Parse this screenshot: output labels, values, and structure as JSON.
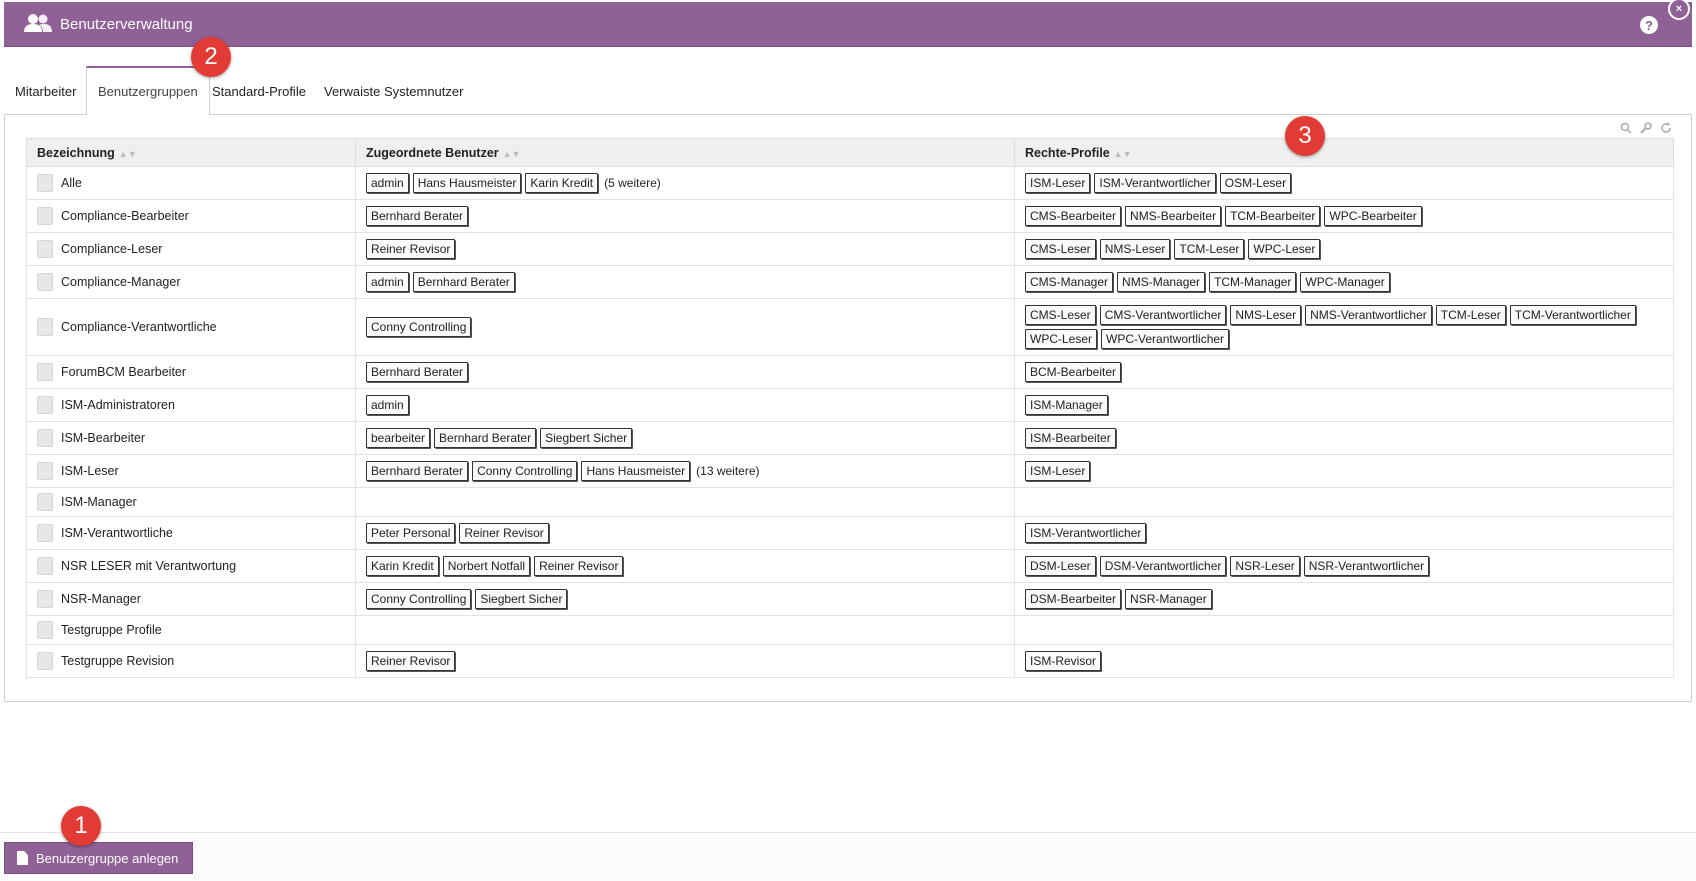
{
  "header": {
    "title": "Benutzerverwaltung",
    "help": "?",
    "close": "×"
  },
  "tabs": [
    {
      "label": "Mitarbeiter"
    },
    {
      "label": "Benutzergruppen"
    },
    {
      "label": "Standard-Profile"
    },
    {
      "label": "Verwaiste Systemnutzer"
    }
  ],
  "table": {
    "columns": [
      "Bezeichnung",
      "Zugeordnete Benutzer",
      "Rechte-Profile"
    ],
    "rows": [
      {
        "name": "Alle",
        "users": [
          "admin",
          "Hans Hausmeister",
          "Karin Kredit"
        ],
        "more": "(5 weitere)",
        "profiles": [
          "ISM-Leser",
          "ISM-Verantwortlicher",
          "OSM-Leser"
        ]
      },
      {
        "name": "Compliance-Bearbeiter",
        "users": [
          "Bernhard Berater"
        ],
        "more": "",
        "profiles": [
          "CMS-Bearbeiter",
          "NMS-Bearbeiter",
          "TCM-Bearbeiter",
          "WPC-Bearbeiter"
        ]
      },
      {
        "name": "Compliance-Leser",
        "users": [
          "Reiner Revisor"
        ],
        "more": "",
        "profiles": [
          "CMS-Leser",
          "NMS-Leser",
          "TCM-Leser",
          "WPC-Leser"
        ]
      },
      {
        "name": "Compliance-Manager",
        "users": [
          "admin",
          "Bernhard Berater"
        ],
        "more": "",
        "profiles": [
          "CMS-Manager",
          "NMS-Manager",
          "TCM-Manager",
          "WPC-Manager"
        ]
      },
      {
        "name": "Compliance-Verantwortliche",
        "users": [
          "Conny Controlling"
        ],
        "more": "",
        "profiles": [
          "CMS-Leser",
          "CMS-Verantwortlicher",
          "NMS-Leser",
          "NMS-Verantwortlicher",
          "TCM-Leser",
          "TCM-Verantwortlicher",
          "WPC-Leser",
          "WPC-Verantwortlicher"
        ]
      },
      {
        "name": "ForumBCM Bearbeiter",
        "users": [
          "Bernhard Berater"
        ],
        "more": "",
        "profiles": [
          "BCM-Bearbeiter"
        ]
      },
      {
        "name": "ISM-Administratoren",
        "users": [
          "admin"
        ],
        "more": "",
        "profiles": [
          "ISM-Manager"
        ]
      },
      {
        "name": "ISM-Bearbeiter",
        "users": [
          "bearbeiter",
          "Bernhard Berater",
          "Siegbert Sicher"
        ],
        "more": "",
        "profiles": [
          "ISM-Bearbeiter"
        ]
      },
      {
        "name": "ISM-Leser",
        "users": [
          "Bernhard Berater",
          "Conny Controlling",
          "Hans Hausmeister"
        ],
        "more": "(13 weitere)",
        "profiles": [
          "ISM-Leser"
        ]
      },
      {
        "name": "ISM-Manager",
        "users": [],
        "more": "",
        "profiles": []
      },
      {
        "name": "ISM-Verantwortliche",
        "users": [
          "Peter Personal",
          "Reiner Revisor"
        ],
        "more": "",
        "profiles": [
          "ISM-Verantwortlicher"
        ]
      },
      {
        "name": "NSR LESER mit Verantwortung",
        "users": [
          "Karin Kredit",
          "Norbert Notfall",
          "Reiner Revisor"
        ],
        "more": "",
        "profiles": [
          "DSM-Leser",
          "DSM-Verantwortlicher",
          "NSR-Leser",
          "NSR-Verantwortlicher"
        ]
      },
      {
        "name": "NSR-Manager",
        "users": [
          "Conny Controlling",
          "Siegbert Sicher"
        ],
        "more": "",
        "profiles": [
          "DSM-Bearbeiter",
          "NSR-Manager"
        ]
      },
      {
        "name": "Testgruppe Profile",
        "users": [],
        "more": "",
        "profiles": []
      },
      {
        "name": "Testgruppe Revision",
        "users": [
          "Reiner Revisor"
        ],
        "more": "",
        "profiles": [
          "ISM-Revisor"
        ]
      }
    ]
  },
  "footer": {
    "create_label": "Benutzergruppe anlegen"
  },
  "badges": [
    "1",
    "2",
    "3"
  ],
  "colors": {
    "accent": "#8f6196",
    "badge": "#e23b35"
  }
}
